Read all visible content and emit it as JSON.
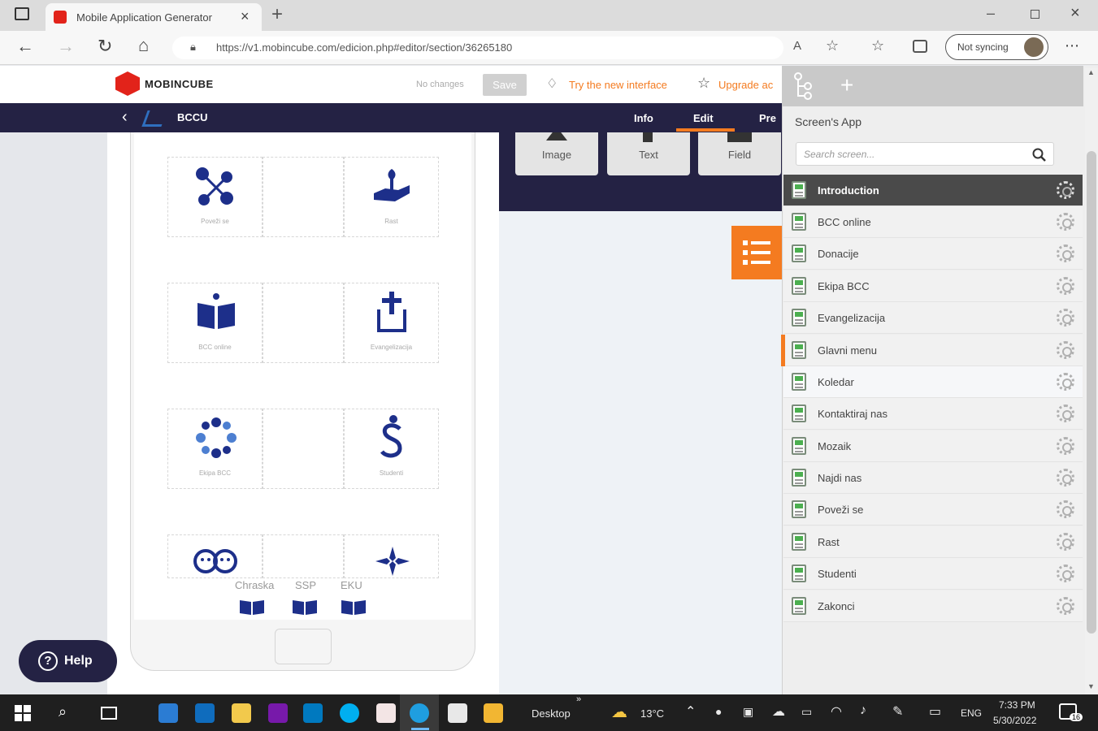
{
  "browser": {
    "tab_title": "Mobile Application Generator",
    "url": "https://v1.mobincube.com/edicion.php#editor/section/36265180",
    "profile_label": "Not syncing"
  },
  "app_header": {
    "logo_text": "MOBINCUBE",
    "status": "No changes",
    "save_label": "Save",
    "try_new_label": "Try the new interface",
    "upgrade_label": "Upgrade ac"
  },
  "nav": {
    "app_name": "BCCU",
    "tabs": [
      {
        "label": "Info"
      },
      {
        "label": "Edit"
      },
      {
        "label": "Pre"
      }
    ]
  },
  "toolbox": {
    "buttons": [
      {
        "label": "Image"
      },
      {
        "label": "Text"
      },
      {
        "label": "Field"
      }
    ]
  },
  "phone_grid": {
    "cells": [
      {
        "label": "Poveži se"
      },
      {
        "label": "Rast"
      },
      {
        "label": "BCC online"
      },
      {
        "label": "Evangelizacija"
      },
      {
        "label": "Ekipa BCC"
      },
      {
        "label": "Studenti"
      }
    ],
    "bottom_labels": [
      "Chraska",
      "SSP",
      "EKU"
    ]
  },
  "help_button": {
    "label": "Help"
  },
  "side_panel": {
    "title": "Screen's App",
    "search_placeholder": "Search screen...",
    "screens": [
      {
        "label": "Introduction"
      },
      {
        "label": "BCC online"
      },
      {
        "label": "Donacije"
      },
      {
        "label": "Ekipa BCC"
      },
      {
        "label": "Evangelizacija"
      },
      {
        "label": "Glavni menu"
      },
      {
        "label": "Koledar"
      },
      {
        "label": "Kontaktiraj nas"
      },
      {
        "label": "Mozaik"
      },
      {
        "label": "Najdi nas"
      },
      {
        "label": "Poveži se"
      },
      {
        "label": "Rast"
      },
      {
        "label": "Studenti"
      },
      {
        "label": "Zakonci"
      }
    ],
    "selected": "Introduction",
    "active_marker": "Glavni menu"
  },
  "taskbar": {
    "desktop_label": "Desktop",
    "weather": "13°C",
    "language": "ENG",
    "time": "7:33 PM",
    "date": "5/30/2022",
    "notification_count": "16"
  },
  "colors": {
    "navy": "#242244",
    "accent_orange": "#f47b20",
    "brand_red": "#e2231a",
    "icon_blue": "#1d2f8a"
  }
}
